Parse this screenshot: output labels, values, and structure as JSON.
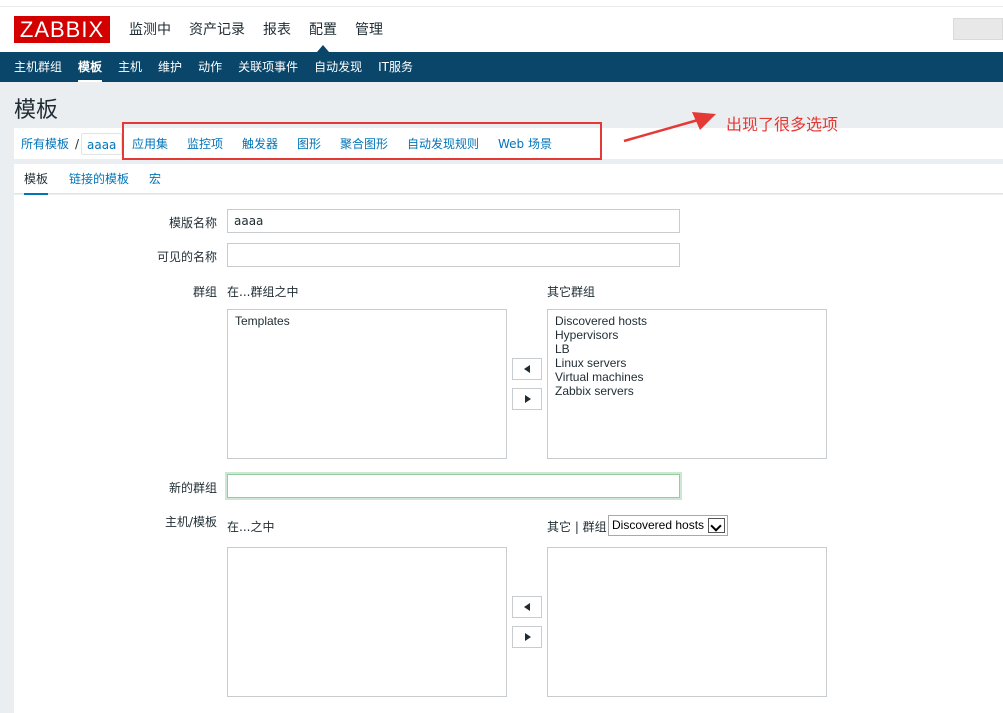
{
  "header": {
    "logo": "ZABBIX",
    "nav": [
      "监测中",
      "资产记录",
      "报表",
      "配置",
      "管理"
    ],
    "active_nav": "配置"
  },
  "subnav": {
    "items": [
      "主机群组",
      "模板",
      "主机",
      "维护",
      "动作",
      "关联项事件",
      "自动发现",
      "IT服务"
    ],
    "active": "模板"
  },
  "page": {
    "title": "模板"
  },
  "breadcrumb": {
    "all_templates": "所有模板",
    "separator": "/",
    "current": "aaaa",
    "links": [
      "应用集",
      "监控项",
      "触发器",
      "图形",
      "聚合图形",
      "自动发现规则",
      "Web 场景"
    ]
  },
  "annotation": {
    "text": "出现了很多选项",
    "color": "#e53935"
  },
  "tabs": [
    "模板",
    "链接的模板",
    "宏"
  ],
  "form": {
    "template_name_label": "模版名称",
    "template_name_value": "aaaa",
    "visible_name_label": "可见的名称",
    "visible_name_value": "",
    "groups_label": "群组",
    "in_groups_caption": "在...群组之中",
    "other_groups_caption": "其它群组",
    "in_groups": [
      "Templates"
    ],
    "other_groups": [
      "Discovered hosts",
      "Hypervisors",
      "LB",
      "Linux servers",
      "Virtual machines",
      "Zabbix servers"
    ],
    "new_group_label": "新的群组",
    "new_group_value": "",
    "hosts_label": "主机/模板",
    "in_hosts_caption": "在...之中",
    "other_hosts_caption": "其它 | 群组",
    "other_hosts_group_select": "Discovered hosts",
    "in_hosts": [],
    "other_hosts": []
  },
  "colors": {
    "nav_bg": "#0a466a",
    "link": "#0275b8",
    "logo_bg": "#d40000"
  }
}
